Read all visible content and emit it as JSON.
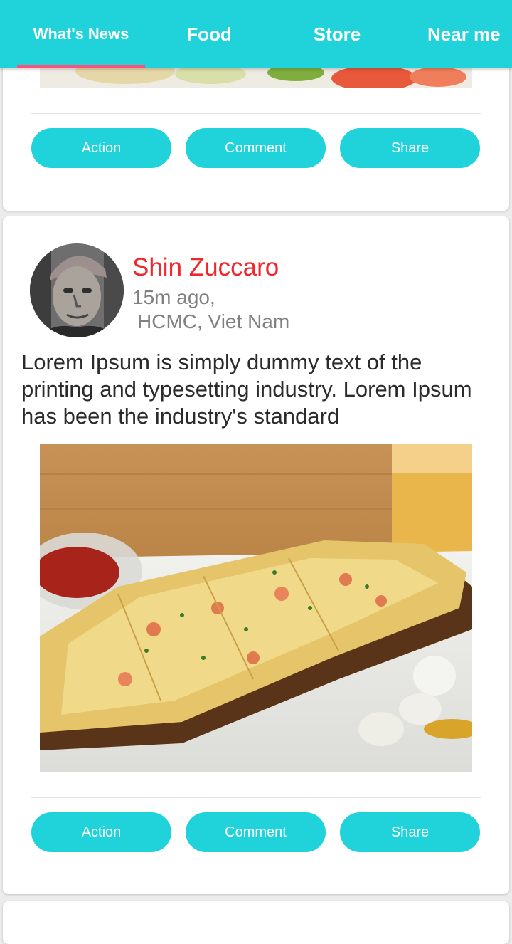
{
  "tabs": [
    {
      "label": "What's News",
      "active": true
    },
    {
      "label": "Food",
      "active": false
    },
    {
      "label": "Store",
      "active": false
    },
    {
      "label": "Near me",
      "active": false
    }
  ],
  "colors": {
    "primary": "#20d3db",
    "tab_indicator": "#ff4f7b",
    "author": "#f0282d",
    "meta_text": "#808080",
    "body_text": "#2b2b2b"
  },
  "previous_post": {
    "actions": {
      "action_label": "Action",
      "comment_label": "Comment",
      "share_label": "Share"
    }
  },
  "post": {
    "author": "Shin Zuccaro",
    "time": "15m ago,",
    "location": "HCMC, Viet Nam",
    "text": "Lorem Ipsum is simply dummy text of the printing and typesetting industry. Lorem Ipsum has been the industry's standard",
    "actions": {
      "action_label": "Action",
      "comment_label": "Comment",
      "share_label": "Share"
    }
  },
  "icons": {
    "avatar": "person-photo",
    "post_image": "pizza-toast-photo"
  }
}
